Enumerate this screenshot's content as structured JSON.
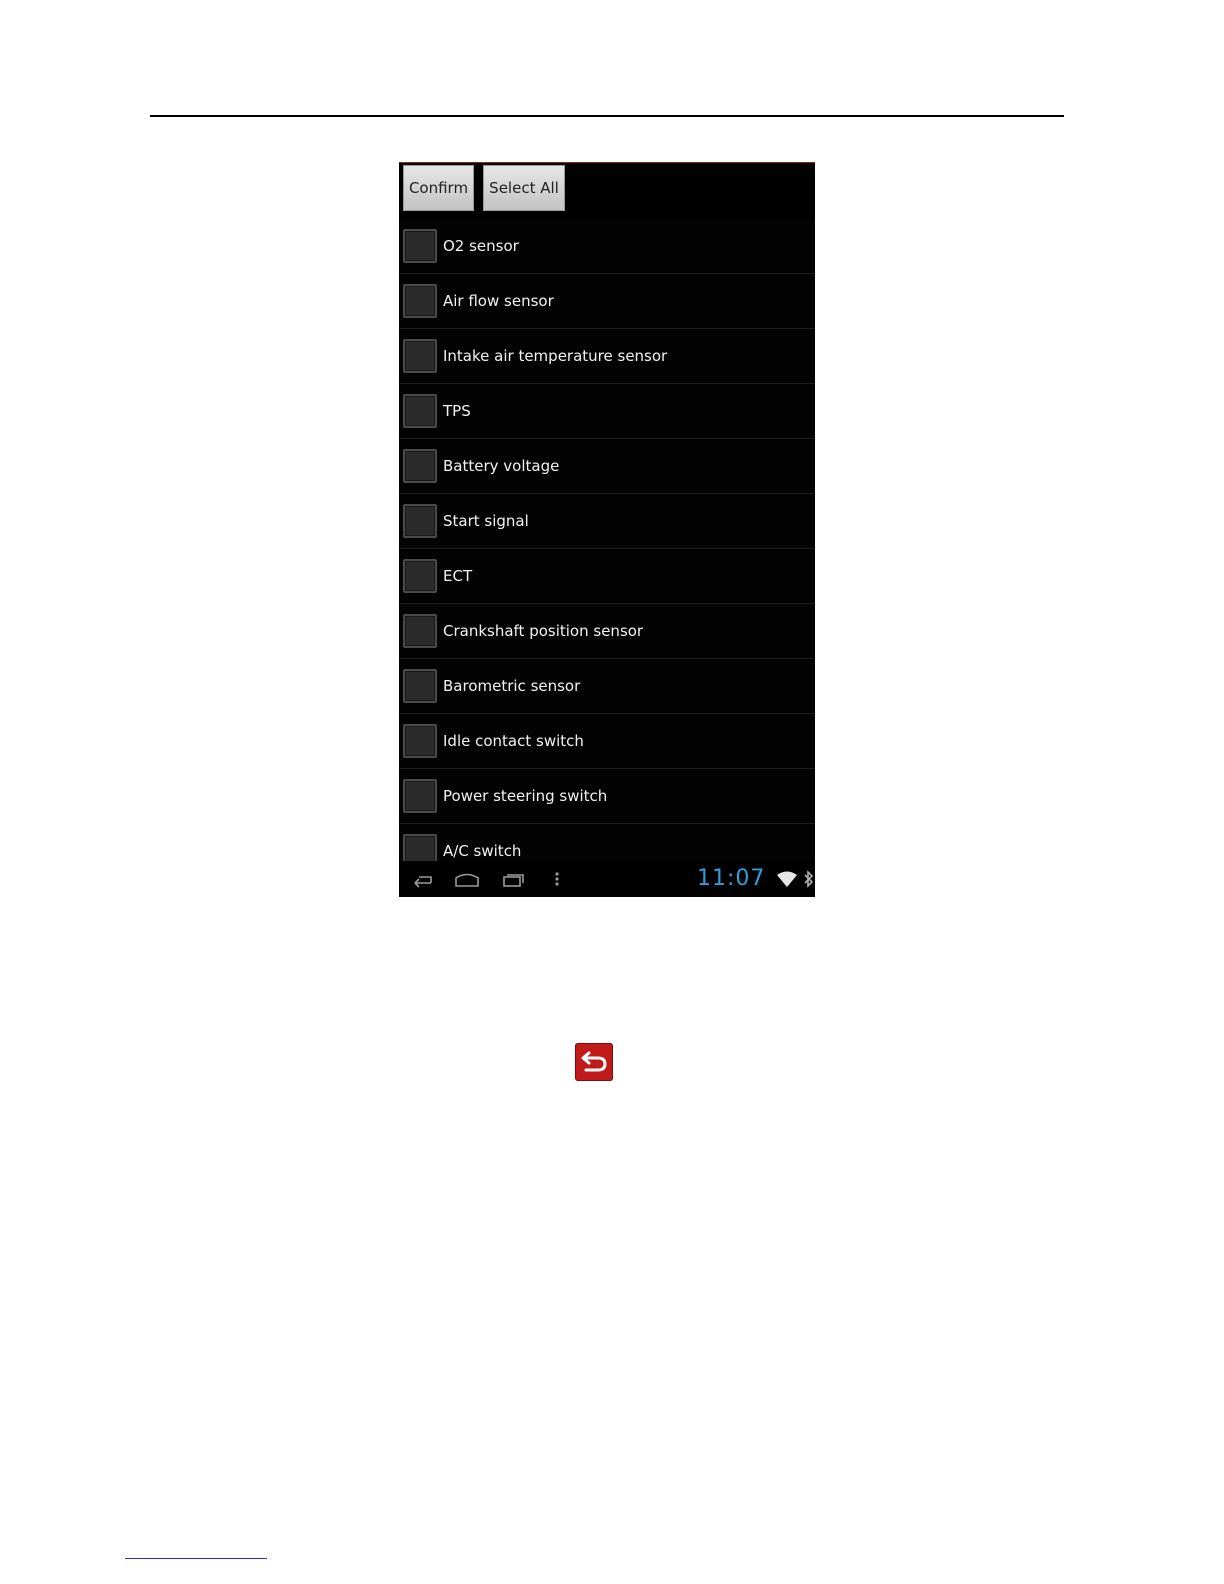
{
  "toolbar": {
    "confirm_label": "Confirm",
    "select_all_label": "Select All"
  },
  "sensor_list": {
    "items": [
      {
        "label": "O2 sensor",
        "checked": false
      },
      {
        "label": "Air flow sensor",
        "checked": false
      },
      {
        "label": "Intake air temperature sensor",
        "checked": false
      },
      {
        "label": "TPS",
        "checked": false
      },
      {
        "label": "Battery voltage",
        "checked": false
      },
      {
        "label": "Start signal",
        "checked": false
      },
      {
        "label": "ECT",
        "checked": false
      },
      {
        "label": "Crankshaft position sensor",
        "checked": false
      },
      {
        "label": "Barometric sensor",
        "checked": false
      },
      {
        "label": "Idle contact switch",
        "checked": false
      },
      {
        "label": "Power steering switch",
        "checked": false
      },
      {
        "label": "A/C switch",
        "checked": false
      }
    ]
  },
  "status_bar": {
    "time": "11:07",
    "icons": [
      "back-icon",
      "home-icon",
      "recent-apps-icon",
      "menu-dots-icon",
      "wifi-icon",
      "bluetooth-icon"
    ]
  },
  "page": {
    "return_icon": "return-arrow-icon",
    "colors": {
      "return_button": "#c11a1a",
      "clock": "#2f9fd8",
      "button_face": "#d4d4d4"
    }
  }
}
